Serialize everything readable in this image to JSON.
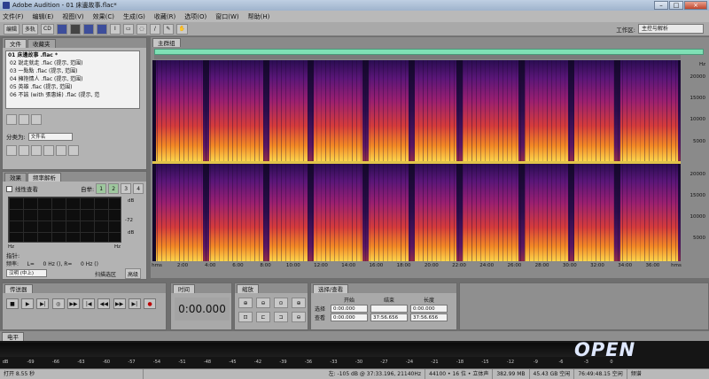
{
  "window": {
    "title": "Adobe Audition - 01 床邊故事.flac*"
  },
  "menu": [
    "文件(F)",
    "编辑(E)",
    "视图(V)",
    "效果(C)",
    "生成(G)",
    "收藏(R)",
    "选项(O)",
    "窗口(W)",
    "帮助(H)"
  ],
  "toolbar": {
    "edit": "编辑",
    "multitrack": "多轨",
    "cd": "CD",
    "workspace_label": "工作区:",
    "workspace_value": "主控与解析"
  },
  "files_panel": {
    "tabs": [
      "文件",
      "收藏夹"
    ],
    "items": [
      "01 床邊故事 .flac *",
      "02 說走就走 .flac (提示, 范围)",
      "03 一點點 .flac (提示, 范围)",
      "04 擁抱情人 .flac (提示, 范围)",
      "05 英雄 .flac (提示, 范围)",
      "06 不該 (with 張惠妹) .flac (提示, 范"
    ],
    "sort_label": "分类为:",
    "sort_value": "文件名"
  },
  "analysis_panel": {
    "tabs": [
      "效果",
      "频率解析"
    ],
    "linear_label": "线性查看",
    "auto_label": "自举:",
    "auto_buttons": [
      "1",
      "2",
      "3",
      "4"
    ],
    "db_labels": [
      "dB",
      "-72",
      "dB"
    ],
    "hz_left": "Hz",
    "hz_right": "Hz",
    "cursor_label": "指针:",
    "freq_line": "频率:     L=     0 Hz (), R=     0 Hz ()",
    "window_select": "汉明 (中上)",
    "scan_label": "扫描选区",
    "advanced_label": "高级"
  },
  "main_panel": {
    "tab": "主群组",
    "hz_ticks_top": [
      "Hz",
      "20000",
      "15000",
      "10000",
      "5000"
    ],
    "hz_ticks_bottom": [
      "20000",
      "15000",
      "10000",
      "5000"
    ],
    "time_ticks": [
      "hms",
      "2:00",
      "4:00",
      "6:00",
      "8:00",
      "10:00",
      "12:00",
      "14:00",
      "16:00",
      "18:00",
      "20:00",
      "22:00",
      "24:00",
      "26:00",
      "28:00",
      "30:00",
      "32:00",
      "34:00",
      "36:00",
      "hms"
    ]
  },
  "transport": {
    "tab": "传送器",
    "buttons": [
      "■",
      "▶",
      "▶|",
      "◎",
      "▶▶",
      "|◀",
      "◀◀",
      "▶▶",
      "▶|",
      "●"
    ]
  },
  "time_panel": {
    "tab": "时间",
    "value": "0:00.000"
  },
  "zoom_panel": {
    "tab": "缩放"
  },
  "selection_panel": {
    "tab": "选择/查看",
    "headers": [
      "开始",
      "结束",
      "长度"
    ],
    "rows": [
      {
        "label": "选择",
        "start": "0:00.000",
        "end": "",
        "length": "0:00.000"
      },
      {
        "label": "查看",
        "start": "0:00.000",
        "end": "37:56.656",
        "length": "37:56.656"
      }
    ]
  },
  "level_panel": {
    "tab": "电平",
    "scale": [
      "dB",
      "-69",
      "-66",
      "-63",
      "-60",
      "-57",
      "-54",
      "-51",
      "-48",
      "-45",
      "-42",
      "-39",
      "-36",
      "-33",
      "-30",
      "-27",
      "-24",
      "-21",
      "-18",
      "-15",
      "-12",
      "-9",
      "-6",
      "-3",
      "0"
    ]
  },
  "status": {
    "open": "打开 8.55 秒",
    "cursor": "左: -105 dB @ 37:33.196, 21140Hz",
    "format": "44100 • 16 位 • 立体声",
    "size": "382.99 MB",
    "free": "45.43 GB 空闲",
    "time": "76:49:48.15 空闲",
    "mode": "频谱"
  },
  "logo": "OPEN"
}
